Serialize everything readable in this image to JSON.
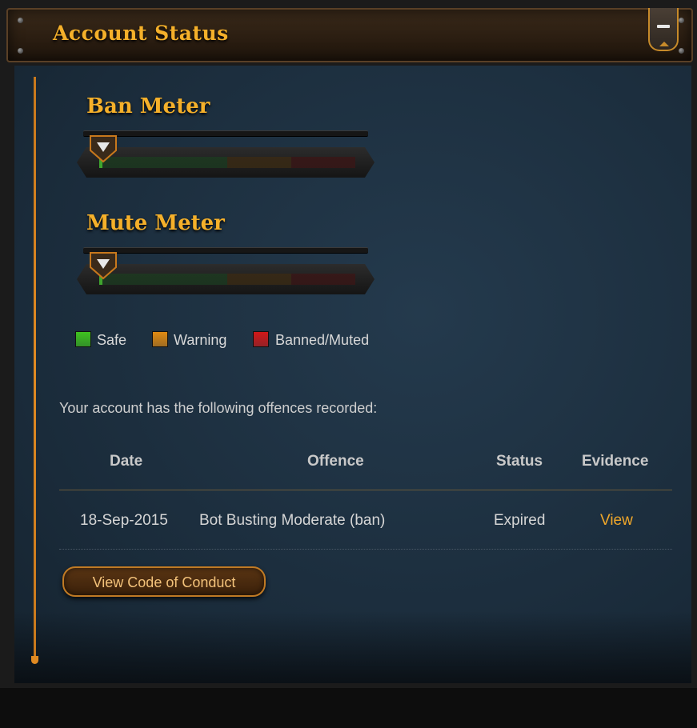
{
  "panel": {
    "title": "Account Status",
    "collapse_icon": "minus-icon"
  },
  "ban_meter": {
    "title": "Ban Meter",
    "level_percent": 0
  },
  "mute_meter": {
    "title": "Mute Meter",
    "level_percent": 0
  },
  "legend": [
    {
      "label": "Safe",
      "color": "#3fc21f"
    },
    {
      "label": "Warning",
      "color": "#e08a12"
    },
    {
      "label": "Banned/Muted",
      "color": "#d01818"
    }
  ],
  "offences": {
    "intro": "Your account has the following offences recorded:",
    "headers": [
      "Date",
      "Offence",
      "Status",
      "Evidence"
    ],
    "rows": [
      {
        "date": "18-Sep-2015",
        "offence": "Bot Busting Moderate (ban)",
        "status": "Expired",
        "evidence": "View"
      }
    ]
  },
  "buttons": {
    "code_of_conduct": "View Code of Conduct"
  },
  "colors": {
    "accent": "#f5b02a",
    "link": "#f0a72a",
    "panel_bg": "#1a2b3a"
  }
}
